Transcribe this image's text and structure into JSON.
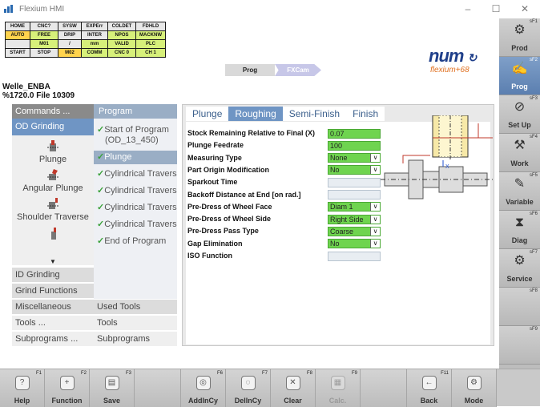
{
  "window": {
    "title": "Flexium HMI",
    "minimize_glyph": "–",
    "maximize_glyph": "☐",
    "close_glyph": "✕"
  },
  "status_grid": {
    "rows": [
      [
        "HOME",
        "CNC?",
        "SYSW",
        "EXPErr",
        "COLDET",
        "FDHLD"
      ],
      [
        "AUTO",
        "FREE",
        "DRIP",
        "INTER",
        "NPOS",
        "MACKNW"
      ],
      [
        "",
        "M01",
        "/",
        "mm",
        "VALID",
        "PLC"
      ],
      [
        "START",
        "STOP",
        "M02",
        "COMM",
        "CNC 0",
        "CH 1"
      ]
    ],
    "colors": {
      "1": [
        "y",
        "g",
        "",
        "",
        "g",
        "g"
      ],
      "2": [
        "",
        "g",
        "",
        "g",
        "g",
        "g"
      ],
      "3": [
        "",
        "",
        "y",
        "g",
        "g",
        "g"
      ]
    }
  },
  "header": {
    "tab_prog": "Prog",
    "tab_fxcam": "FXCam",
    "brand": "num",
    "brand_sub": "flexium+68"
  },
  "left": {
    "part_name": "Welle_ENBA",
    "file_label": "%1720.0 File 10309",
    "commands_header": "Commands ...",
    "program_header": "Program",
    "commands": {
      "active": "OD Grinding",
      "tools": [
        "Plunge",
        "Angular Plunge",
        "Shoulder Traverse"
      ],
      "more_arrow": "▼"
    },
    "program_items": [
      {
        "label": "Start of Program",
        "sub": "(OD_13_450)",
        "selected": false
      },
      {
        "label": "Plunge",
        "sub": "",
        "selected": true
      },
      {
        "label": "Cylindrical Travers",
        "sub": "",
        "selected": false
      },
      {
        "label": "Cylindrical Travers",
        "sub": "",
        "selected": false
      },
      {
        "label": "Cylindrical Travers",
        "sub": "",
        "selected": false
      },
      {
        "label": "Cylindrical Travers",
        "sub": "",
        "selected": false
      },
      {
        "label": "End of Program",
        "sub": "",
        "selected": false
      }
    ],
    "bottom_rows_left": [
      "ID Grinding",
      "Grind Functions",
      "Miscellaneous",
      "Tools ...",
      "Subprograms ..."
    ],
    "bottom_rows_right": [
      "Used Tools",
      "Tools",
      "Subprograms"
    ]
  },
  "main": {
    "tabs": [
      "Plunge",
      "Roughing",
      "Semi-Finish",
      "Finish"
    ],
    "active_tab": "Roughing",
    "fields": [
      {
        "label": "Stock Remaining Relative to Final (X)",
        "value": "0.07",
        "kind": "input-green"
      },
      {
        "label": "Plunge Feedrate",
        "value": "100",
        "kind": "input-green"
      },
      {
        "label": "Measuring Type",
        "value": "None",
        "kind": "select"
      },
      {
        "label": "Part Origin Modification",
        "value": "No",
        "kind": "select"
      },
      {
        "label": "Sparkout Time",
        "value": "",
        "kind": "input"
      },
      {
        "label": "Backoff Distance at End [on rad.]",
        "value": "",
        "kind": "input"
      },
      {
        "label": "Pre-Dress of Wheel Face",
        "value": "Diam 1",
        "kind": "select"
      },
      {
        "label": "Pre-Dress of Wheel Side",
        "value": "Right Side",
        "kind": "select"
      },
      {
        "label": "Pre-Dress Pass Type",
        "value": "Coarse",
        "kind": "select"
      },
      {
        "label": "Gap Elimination",
        "value": "No",
        "kind": "select"
      },
      {
        "label": "ISO Function",
        "value": "",
        "kind": "input"
      }
    ],
    "diagram_axis_label": "X"
  },
  "softkeys_right": [
    {
      "label": "Prod",
      "fnum": "sF1",
      "icon": "prod-gears-icon",
      "glyph": "⚙",
      "active": false
    },
    {
      "label": "Prog",
      "fnum": "sF2",
      "icon": "prog-hand-icon",
      "glyph": "✍",
      "active": true
    },
    {
      "label": "Set Up",
      "fnum": "sF3",
      "icon": "setup-caliper-icon",
      "glyph": "⊘",
      "active": false
    },
    {
      "label": "Work",
      "fnum": "sF4",
      "icon": "work-tool-icon",
      "glyph": "⚒",
      "active": false
    },
    {
      "label": "Variable",
      "fnum": "sF5",
      "icon": "variable-book-icon",
      "glyph": "✎",
      "active": false
    },
    {
      "label": "Diag",
      "fnum": "sF6",
      "icon": "diag-icon",
      "glyph": "⧗",
      "active": false
    },
    {
      "label": "Service",
      "fnum": "sF7",
      "icon": "service-gear-icon",
      "glyph": "⚙",
      "active": false
    },
    {
      "label": "",
      "fnum": "sF8",
      "icon": "",
      "glyph": "",
      "active": false
    },
    {
      "label": "",
      "fnum": "sF9",
      "icon": "",
      "glyph": "",
      "active": false
    }
  ],
  "softkeys_bottom": [
    {
      "label": "Help",
      "fnum": "F1",
      "icon": "help-icon",
      "glyph": "?",
      "disabled": false
    },
    {
      "label": "Function",
      "fnum": "F2",
      "icon": "function-icon",
      "glyph": "+",
      "disabled": false
    },
    {
      "label": "Save",
      "fnum": "F3",
      "icon": "save-icon",
      "glyph": "▤",
      "disabled": false
    },
    {
      "label": "",
      "fnum": "",
      "icon": "",
      "glyph": "",
      "disabled": false
    },
    {
      "label": "AddInCy",
      "fnum": "F6",
      "icon": "add-in-cycle-icon",
      "glyph": "◎",
      "disabled": false
    },
    {
      "label": "DelInCy",
      "fnum": "F7",
      "icon": "delete-in-cycle-icon",
      "glyph": "◌",
      "disabled": false
    },
    {
      "label": "Clear",
      "fnum": "F8",
      "icon": "clear-icon",
      "glyph": "✕",
      "disabled": false
    },
    {
      "label": "Calc.",
      "fnum": "F9",
      "icon": "calculator-icon",
      "glyph": "▦",
      "disabled": true
    },
    {
      "label": "",
      "fnum": "",
      "icon": "",
      "glyph": "",
      "disabled": false
    },
    {
      "label": "Back",
      "fnum": "F11",
      "icon": "back-icon",
      "glyph": "←",
      "disabled": false
    },
    {
      "label": "Mode",
      "fnum": "",
      "icon": "mode-icon",
      "glyph": "⚙",
      "disabled": false
    }
  ]
}
